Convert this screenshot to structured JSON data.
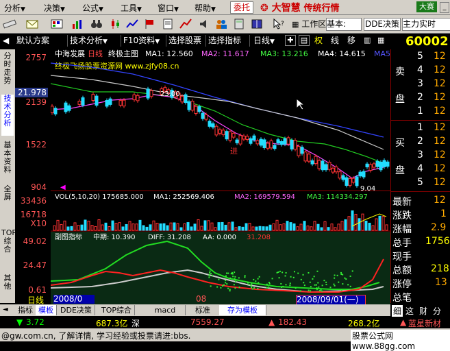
{
  "menubar": {
    "items": [
      {
        "label": "分析"
      },
      {
        "label": "决策"
      },
      {
        "label": "公式"
      },
      {
        "label": "工具"
      },
      {
        "label": "窗口"
      },
      {
        "label": "帮助"
      }
    ],
    "trade_label": "委托",
    "brand_name": "大智慧",
    "brand_sub": "传统行情",
    "dasai_label": "大赛"
  },
  "toolbar": {
    "workspace_label": "工作区",
    "basic_select": "基本:",
    "dde_label": "DDE决策",
    "zlss_label": "主力实时"
  },
  "funcbar": {
    "items": [
      {
        "label": "默认方案"
      },
      {
        "label": "技术分析"
      },
      {
        "label": "F10资料"
      },
      {
        "label": "选择股票"
      },
      {
        "label": "选择指标"
      },
      {
        "label": "日线"
      },
      {
        "label": "权"
      },
      {
        "label": "线"
      },
      {
        "label": "移"
      }
    ]
  },
  "stock_code": "60002",
  "left_tabs": [
    {
      "label": "分时走势"
    },
    {
      "label": "技术分析"
    },
    {
      "label": "基本资料"
    },
    {
      "label": "全屏"
    },
    {
      "label": "TOP综合"
    },
    {
      "label": "其他"
    }
  ],
  "main_chart": {
    "title": "中海发展",
    "period": "日线",
    "template": "终极主图",
    "ma1": "MA1: 12.560",
    "ma2": "MA2: 11.617",
    "ma3": "MA3: 13.216",
    "ma4": "MA4: 14.615",
    "ma5": "MA5:",
    "watermark": "终极飞扬股票资源网 www.zjfy08.cn",
    "high_label": "23.00",
    "low_label": "9.04",
    "mid_label": "进"
  },
  "vol_chart": {
    "header": "VOL(5,10,20) 175685.000",
    "ma1": "MA1: 252569.406",
    "ma2": "MA2: 169579.594",
    "ma3": "MA3: 114334.297",
    "unit": "X10"
  },
  "sub_chart": {
    "header": "副图指标",
    "mid": "中期: 10.390",
    "diff": "DIFF: 31.208",
    "aa": "AA: 0.000",
    "red": "31.208"
  },
  "y_labels": {
    "main": [
      "2757",
      "2139",
      "1522",
      "904"
    ],
    "current": "21.978",
    "vol": [
      "33436",
      "16718"
    ],
    "sub": [
      "49.02",
      "24.47",
      "0.61"
    ]
  },
  "x_labels": {
    "period_label": "日线",
    "start": "2008/0",
    "mid": "08",
    "end": "2008/09/01(一)"
  },
  "right_panel": {
    "sell_label": "卖",
    "sell_label2": "盘",
    "buy_label": "买",
    "buy_label2": "盘",
    "sell_rows": [
      {
        "n": "5",
        "v": "12"
      },
      {
        "n": "4",
        "v": "12"
      },
      {
        "n": "3",
        "v": "12"
      },
      {
        "n": "2",
        "v": "12"
      },
      {
        "n": "1",
        "v": "12"
      }
    ],
    "buy_rows": [
      {
        "n": "1",
        "v": "12"
      },
      {
        "n": "2",
        "v": "12"
      },
      {
        "n": "3",
        "v": "12"
      },
      {
        "n": "4",
        "v": "12"
      },
      {
        "n": "5",
        "v": "12"
      }
    ],
    "stats": [
      {
        "label": "最新",
        "val": "12"
      },
      {
        "label": "涨跌",
        "val": "1"
      },
      {
        "label": "涨幅",
        "val": "2.9"
      },
      {
        "label": "总手",
        "val": "1756"
      },
      {
        "label": "现手",
        "val": ""
      },
      {
        "label": "总额",
        "val": "218"
      },
      {
        "label": "涨停",
        "val": "13"
      },
      {
        "label": "总笔",
        "val": ""
      }
    ]
  },
  "bottom_tabs": [
    {
      "label": "指标"
    },
    {
      "label": "模板"
    },
    {
      "label": "DDE决策"
    },
    {
      "label": "TOP综合"
    },
    {
      "label": "macd"
    },
    {
      "label": "标准"
    },
    {
      "label": "存为模板"
    }
  ],
  "right_bottom_tabs": [
    {
      "label": "细"
    },
    {
      "label": "这"
    },
    {
      "label": "财"
    },
    {
      "label": "分"
    }
  ],
  "index_bar": {
    "i1": "3.72",
    "i2": "687.3亿",
    "i2b": "深",
    "i3": "7559.27",
    "i4": "182.43",
    "i5": "268.2亿",
    "i6": "蓝星新材"
  },
  "status": {
    "left": "@gw.com.cn, 了解详情, 学习经验或投票请进:bbs.",
    "right": "股票公式网 www.88gg.com"
  },
  "chart_data": {
    "type": "candlestick",
    "y_axis_ticks": [
      2757,
      2139,
      1522,
      904
    ],
    "current_price": 21.978,
    "x_axis_labels": [
      "2008/0",
      "08",
      "2008/09/01(一)"
    ],
    "ma_values": {
      "MA1": 12.56,
      "MA2": 11.617,
      "MA3": 13.216,
      "MA4": 14.615
    },
    "annotations": [
      {
        "text": "23.00"
      },
      {
        "text": "9.04"
      }
    ],
    "volume": {
      "ticks": [
        33436,
        16718
      ],
      "vol": 175685.0,
      "MA1": 252569.406,
      "MA2": 169579.594,
      "MA3": 114334.297
    },
    "sub_indicator": {
      "ticks": [
        49.02,
        24.47,
        0.61
      ],
      "mid": 10.39,
      "DIFF": 31.208,
      "AA": 0.0
    }
  }
}
